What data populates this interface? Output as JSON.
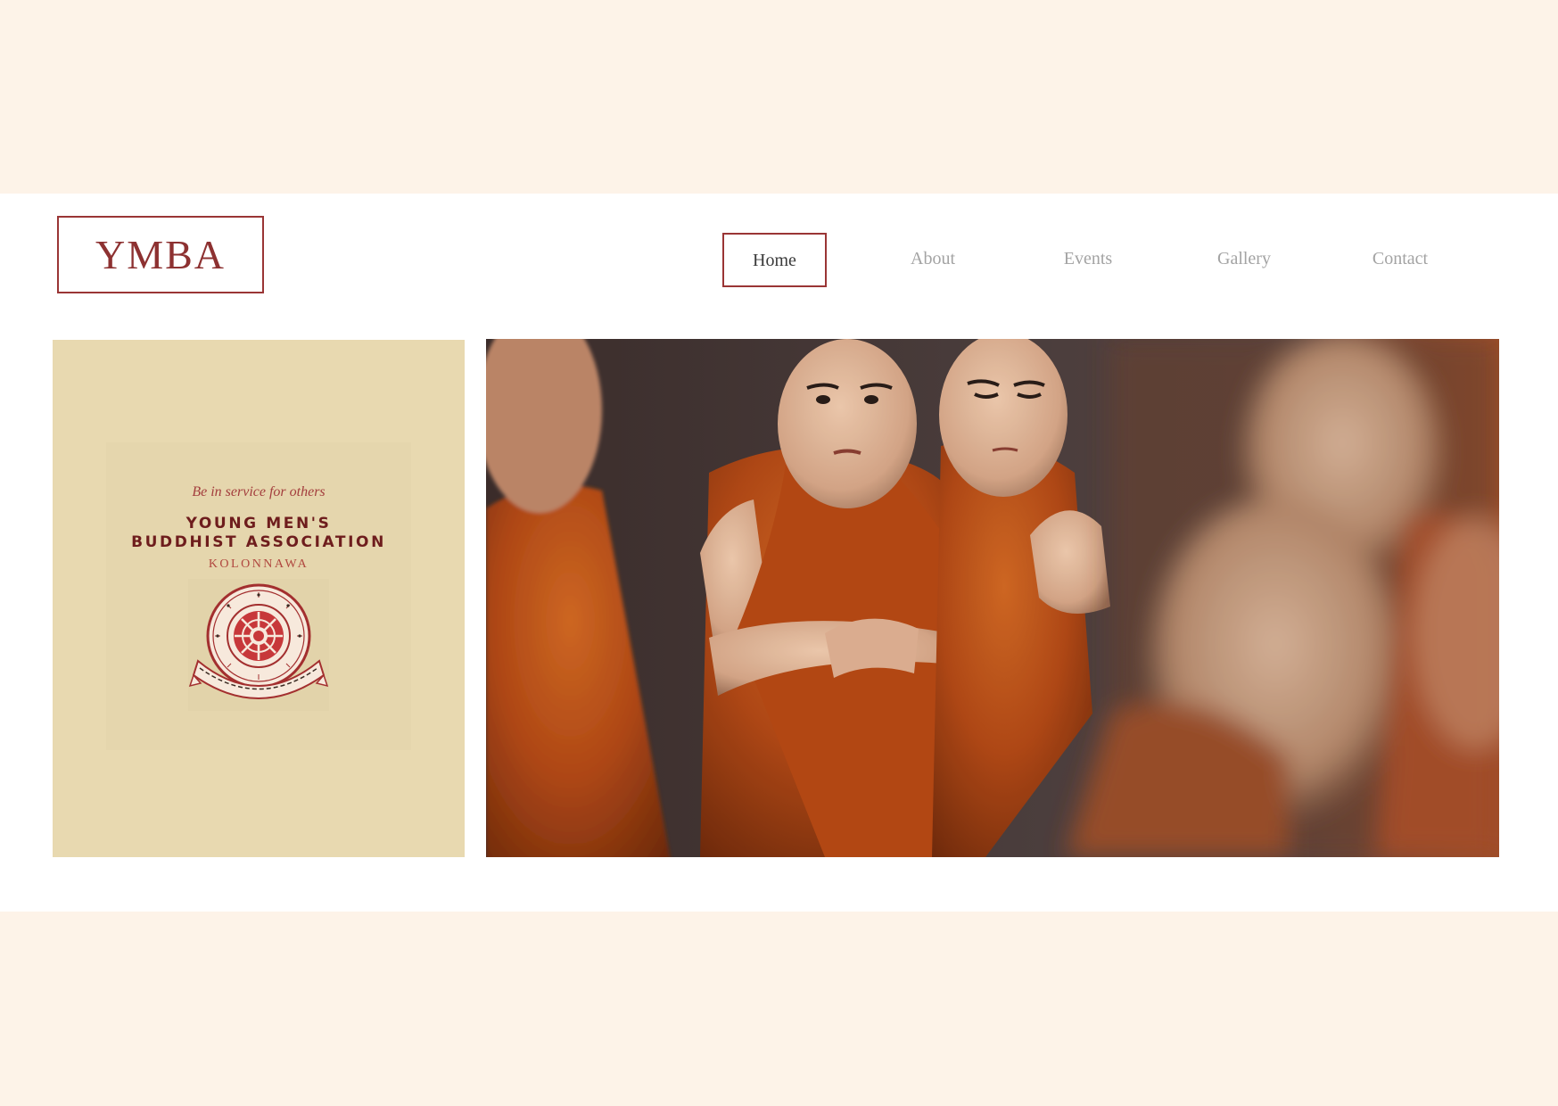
{
  "logo": {
    "text": "YMBA"
  },
  "nav": {
    "items": [
      {
        "label": "Home",
        "active": true
      },
      {
        "label": "About",
        "active": false
      },
      {
        "label": "Events",
        "active": false
      },
      {
        "label": "Gallery",
        "active": false
      },
      {
        "label": "Contact",
        "active": false
      }
    ]
  },
  "card": {
    "tagline": "Be in service for others",
    "org_line1": "YOUNG MEN'S",
    "org_line2": "BUDDHIST ASSOCIATION",
    "location": "KOLONNAWA"
  },
  "colors": {
    "page_background": "#fdf3e8",
    "accent_maroon": "#9a3535",
    "card_beige": "#e8d9b0",
    "nav_inactive": "#a3a3a3",
    "robe_orange": "#b84a14"
  }
}
